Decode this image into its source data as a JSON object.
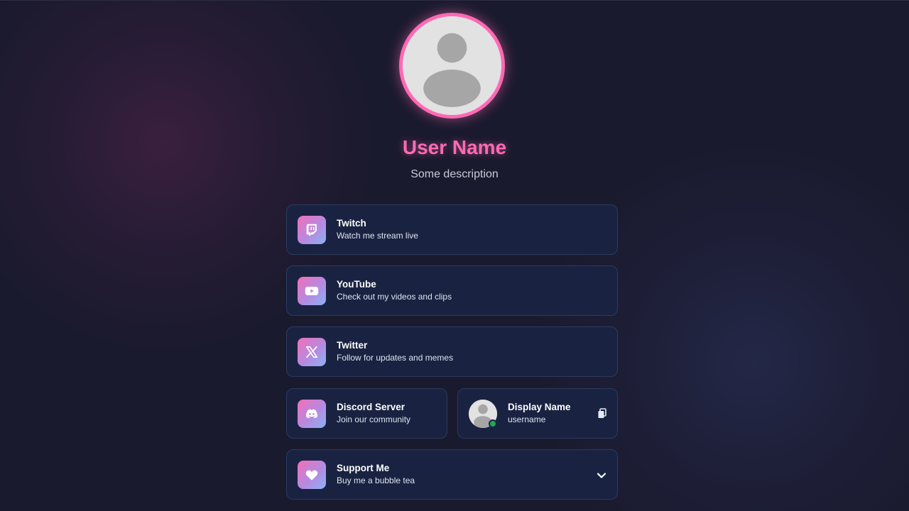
{
  "profile": {
    "name": "User Name",
    "description": "Some description",
    "avatar_icon": "default-user-avatar"
  },
  "links": [
    {
      "title": "Twitch",
      "subtitle": "Watch me stream live",
      "icon": "twitch-icon"
    },
    {
      "title": "YouTube",
      "subtitle": "Check out my videos and clips",
      "icon": "youtube-icon"
    },
    {
      "title": "Twitter",
      "subtitle": "Follow for updates and memes",
      "icon": "x-twitter-icon"
    },
    {
      "title": "Discord Server",
      "subtitle": "Join our community",
      "icon": "discord-icon"
    }
  ],
  "discord_user": {
    "display_name": "Display Name",
    "username": "username",
    "status": "online",
    "copy_icon": "copy-icon"
  },
  "support": {
    "title": "Support Me",
    "subtitle": "Buy me a bubble tea",
    "icon": "heart-icon",
    "toggle_icon": "chevron-down-icon"
  },
  "colors": {
    "accent": "#ff69b4",
    "background": "#1a1a2e",
    "card": "#192341",
    "card_border": "#2d3a5c",
    "online": "#23a55a"
  }
}
